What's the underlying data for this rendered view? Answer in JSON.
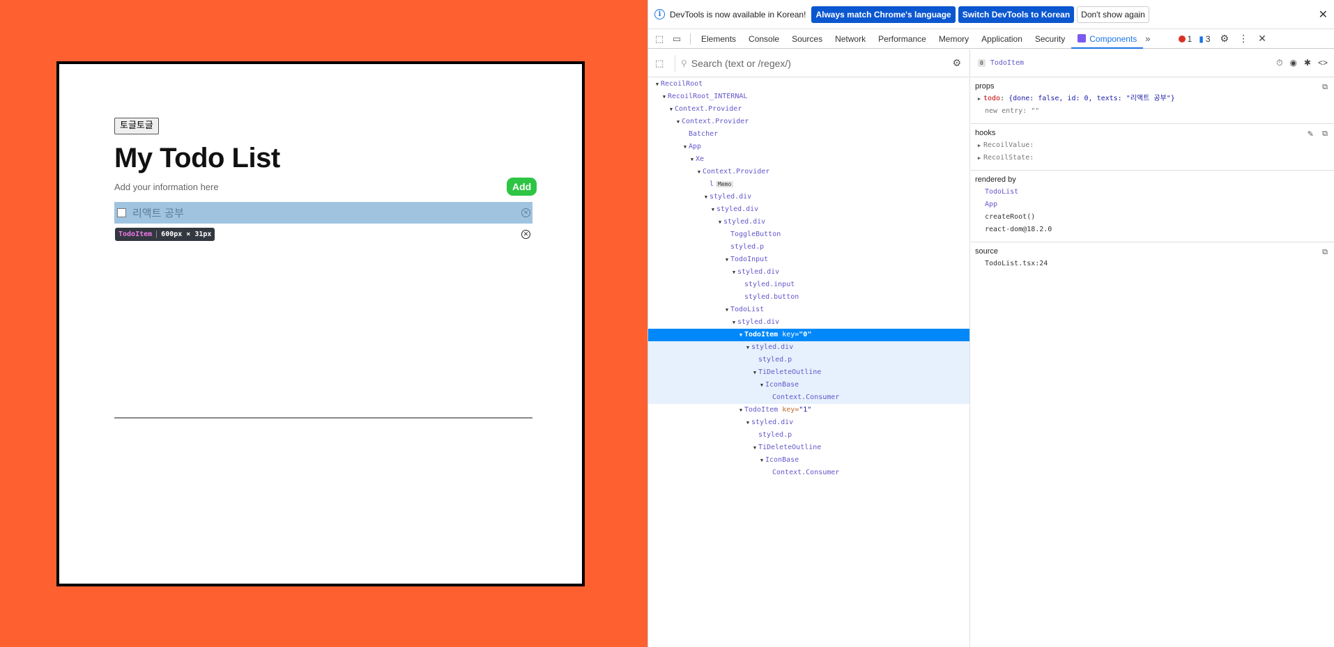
{
  "app": {
    "toggle_label": "토글토글",
    "title": "My Todo List",
    "input_placeholder": "Add your information here",
    "add_label": "Add",
    "todos": [
      {
        "text": "리액트 공부"
      },
      {
        "text": ""
      }
    ],
    "highlight": {
      "name": "TodoItem",
      "size": "600px × 31px"
    }
  },
  "devtools": {
    "infobar": {
      "text": "DevTools is now available in Korean!",
      "btn_match": "Always match Chrome's language",
      "btn_switch": "Switch DevTools to Korean",
      "btn_dismiss": "Don't show again"
    },
    "tabs": [
      "Elements",
      "Console",
      "Sources",
      "Network",
      "Performance",
      "Memory",
      "Application",
      "Security",
      "Components"
    ],
    "active_tab": "Components",
    "error_count": "1",
    "message_count": "3",
    "search_placeholder": "Search (text or /regex/)",
    "tree": [
      {
        "label": "RecoilRoot",
        "depth": 0
      },
      {
        "label": "RecoilRoot_INTERNAL",
        "depth": 1
      },
      {
        "label": "Context.Provider",
        "depth": 2
      },
      {
        "label": "Context.Provider",
        "depth": 3
      },
      {
        "label": "Batcher",
        "depth": 4
      },
      {
        "label": "App",
        "depth": 4
      },
      {
        "label": "Xe",
        "depth": 5
      },
      {
        "label": "Context.Provider",
        "depth": 6
      },
      {
        "label": "l",
        "depth": 7,
        "badge": "Memo"
      },
      {
        "label": "styled.div",
        "depth": 7
      },
      {
        "label": "styled.div",
        "depth": 8
      },
      {
        "label": "styled.div",
        "depth": 9
      },
      {
        "label": "ToggleButton",
        "depth": 10
      },
      {
        "label": "styled.p",
        "depth": 10
      },
      {
        "label": "TodoInput",
        "depth": 10
      },
      {
        "label": "styled.div",
        "depth": 11
      },
      {
        "label": "styled.input",
        "depth": 12
      },
      {
        "label": "styled.button",
        "depth": 12
      },
      {
        "label": "TodoList",
        "depth": 10
      },
      {
        "label": "styled.div",
        "depth": 11
      },
      {
        "label": "TodoItem",
        "depth": 12,
        "key": "0",
        "selected": true
      },
      {
        "label": "styled.div",
        "depth": 13,
        "sub": true
      },
      {
        "label": "styled.p",
        "depth": 14,
        "sub": true
      },
      {
        "label": "TiDeleteOutline",
        "depth": 14,
        "sub": true
      },
      {
        "label": "IconBase",
        "depth": 15,
        "sub": true
      },
      {
        "label": "Context.Consumer",
        "depth": 16,
        "sub": true
      },
      {
        "label": "TodoItem",
        "depth": 12,
        "key": "1"
      },
      {
        "label": "styled.div",
        "depth": 13
      },
      {
        "label": "styled.p",
        "depth": 14
      },
      {
        "label": "TiDeleteOutline",
        "depth": 14
      },
      {
        "label": "IconBase",
        "depth": 15
      },
      {
        "label": "Context.Consumer",
        "depth": 16
      }
    ],
    "inspector": {
      "badge": "0",
      "component": "TodoItem",
      "props_title": "props",
      "prop_todo_name": "todo",
      "prop_todo_value": "{done: false, id: 0, texts: \"리액트 공부\"}",
      "new_entry": "new entry: \"\"",
      "hooks_title": "hooks",
      "hooks": [
        "RecoilValue:",
        "RecoilState:"
      ],
      "rendered_title": "rendered by",
      "rendered_by": [
        "TodoList",
        "App",
        "createRoot()",
        "react-dom@18.2.0"
      ],
      "source_title": "source",
      "source": "TodoList.tsx:24"
    }
  }
}
